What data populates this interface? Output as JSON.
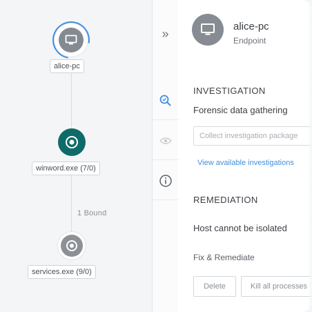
{
  "graph": {
    "nodes": [
      {
        "label": "alice-pc",
        "icon": "monitor-icon"
      },
      {
        "label": "winword.exe (7/0)",
        "icon": "process-icon"
      },
      {
        "label": "services.exe (9/0)",
        "icon": "process-icon"
      }
    ],
    "edge_label": "1 Bound"
  },
  "toolbar": {
    "collapse_glyph": "»",
    "items": [
      "investigate-icon",
      "eye-icon",
      "info-icon"
    ]
  },
  "panel": {
    "host_name": "alice-pc",
    "host_type": "Endpoint",
    "investigation_title": "INVESTIGATION",
    "forensic_label": "Forensic data gathering",
    "select_placeholder": "Collect investigation package",
    "link_text": "View available investigations",
    "remediation_title": "REMEDIATION",
    "isolate_text": "Host cannot be isolated",
    "fix_label": "Fix & Remediate",
    "button_1": "Delete",
    "button_2": "Kill all processes"
  },
  "colors": {
    "accent": "#3f8fe0",
    "process_active": "#0f6b6a",
    "node_gray": "#858a90"
  }
}
